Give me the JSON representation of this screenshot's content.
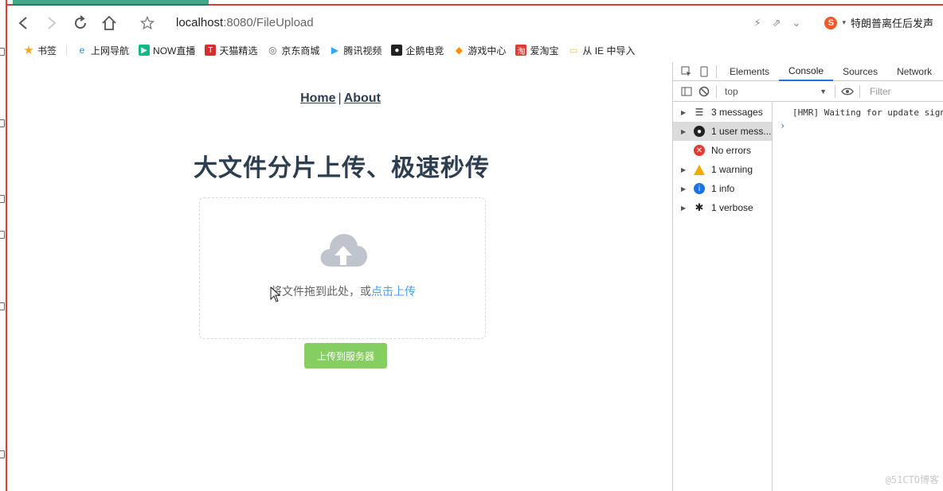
{
  "browser": {
    "url_host": "localhost",
    "url_rest": ":8080/FileUpload",
    "hot_search": "特朗普离任后发声"
  },
  "bookmarks": [
    {
      "label": "书签",
      "icon": "star-icon",
      "color": "#f5a623"
    },
    {
      "label": "上网导航",
      "icon": "ie-icon",
      "color": "#1e88e5"
    },
    {
      "label": "NOW直播",
      "icon": "now-icon",
      "color": "#12b886"
    },
    {
      "label": "天猫精选",
      "icon": "tmall-icon",
      "color": "#d32f2f"
    },
    {
      "label": "京东商城",
      "icon": "globe-icon",
      "color": "#666666"
    },
    {
      "label": "腾讯视频",
      "icon": "play-icon",
      "color": "#2aa7ff"
    },
    {
      "label": "企鹅电竞",
      "icon": "penguin-icon",
      "color": "#222222"
    },
    {
      "label": "游戏中心",
      "icon": "gamepad-icon",
      "color": "#ff8f00"
    },
    {
      "label": "爱淘宝",
      "icon": "taobao-icon",
      "color": "#e53935"
    },
    {
      "label": "从 IE 中导入",
      "icon": "folder-icon",
      "color": "#f2c94c"
    }
  ],
  "page": {
    "nav_home": "Home",
    "nav_sep": "|",
    "nav_about": "About",
    "title": "大文件分片上传、极速秒传",
    "drop_text": "将文件拖到此处，或",
    "drop_link": "点击上传",
    "upload_button": "上传到服务器"
  },
  "devtools": {
    "tabs": [
      "Elements",
      "Console",
      "Sources",
      "Network"
    ],
    "active_tab": "Console",
    "context": "top",
    "filter_placeholder": "Filter",
    "sidebar": [
      {
        "label": "3 messages",
        "icon": "list-icon",
        "color": "#333333",
        "expandable": true,
        "selected": false
      },
      {
        "label": "1 user mess...",
        "icon": "user-icon",
        "color": "#222222",
        "expandable": true,
        "selected": true
      },
      {
        "label": "No errors",
        "icon": "error-icon",
        "color": "#e53935",
        "expandable": false,
        "selected": false
      },
      {
        "label": "1 warning",
        "icon": "warning-icon",
        "color": "#f2a900",
        "expandable": true,
        "selected": false
      },
      {
        "label": "1 info",
        "icon": "info-icon",
        "color": "#1a73e8",
        "expandable": true,
        "selected": false
      },
      {
        "label": "1 verbose",
        "icon": "bug-icon",
        "color": "#222222",
        "expandable": true,
        "selected": false
      }
    ],
    "console_line": "[HMR] Waiting for update signal from WDS..."
  },
  "watermark": "@51CTO博客"
}
